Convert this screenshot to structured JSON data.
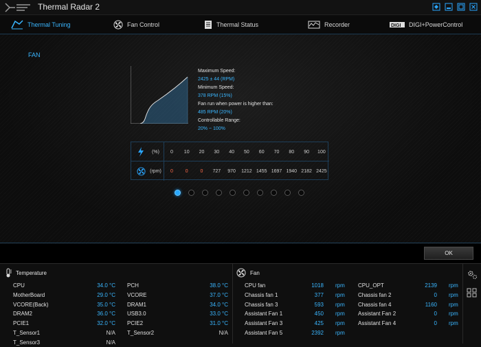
{
  "app": {
    "title": "Thermal Radar 2"
  },
  "tabs": [
    {
      "label": "Thermal Tuning",
      "icon": "thermal-tuning-icon"
    },
    {
      "label": "Fan Control",
      "icon": "fan-icon"
    },
    {
      "label": "Thermal Status",
      "icon": "document-icon"
    },
    {
      "label": "Recorder",
      "icon": "recorder-icon"
    },
    {
      "label": "DIGI+PowerControl",
      "icon": "digi-icon"
    }
  ],
  "fan_section": {
    "title": "FAN",
    "max_speed_label": "Maximum Speed:",
    "max_speed_value": "2425 ± 44 (RPM)",
    "min_speed_label": "Minimum Speed:",
    "min_speed_value": "378 RPM (15%)",
    "fan_run_label": "Fan run when power is higher than:",
    "fan_run_value": "485 RPM (20%)",
    "range_label": "Controllable Range:",
    "range_value": "20% ~ 100%",
    "table": {
      "pct_unit": "(%)",
      "rpm_unit": "(rpm)",
      "percent": [
        "0",
        "10",
        "20",
        "30",
        "40",
        "50",
        "60",
        "70",
        "80",
        "90",
        "100"
      ],
      "rpm": [
        "0",
        "0",
        "0",
        "727",
        "970",
        "1212",
        "1455",
        "1697",
        "1940",
        "2182",
        "2425"
      ]
    },
    "pager": {
      "count": 10,
      "active": 0
    }
  },
  "ok_label": "OK",
  "temperature": {
    "title": "Temperature",
    "left": [
      {
        "name": "CPU",
        "value": "34.0 °C"
      },
      {
        "name": "MotherBoard",
        "value": "29.0 °C"
      },
      {
        "name": "VCORE(Back)",
        "value": "35.0 °C"
      },
      {
        "name": "DRAM2",
        "value": "36.0 °C"
      },
      {
        "name": "PCIE1",
        "value": "32.0 °C"
      },
      {
        "name": "T_Sensor1",
        "value": "N/A"
      },
      {
        "name": "T_Sensor3",
        "value": "N/A"
      }
    ],
    "right": [
      {
        "name": "PCH",
        "value": "38.0 °C"
      },
      {
        "name": "VCORE",
        "value": "37.0 °C"
      },
      {
        "name": "DRAM1",
        "value": "34.0 °C"
      },
      {
        "name": "USB3.0",
        "value": "33.0 °C"
      },
      {
        "name": "PCIE2",
        "value": "31.0 °C"
      },
      {
        "name": "T_Sensor2",
        "value": "N/A"
      }
    ]
  },
  "fans": {
    "title": "Fan",
    "unit": "rpm",
    "left": [
      {
        "name": "CPU fan",
        "value": "1018"
      },
      {
        "name": "Chassis fan 1",
        "value": "377"
      },
      {
        "name": "Chassis fan 3",
        "value": "593"
      },
      {
        "name": "Assistant Fan 1",
        "value": "450"
      },
      {
        "name": "Assistant Fan 3",
        "value": "425"
      },
      {
        "name": "Assistant Fan 5",
        "value": "2392"
      }
    ],
    "right": [
      {
        "name": "CPU_OPT",
        "value": "2139"
      },
      {
        "name": "Chassis fan 2",
        "value": "0"
      },
      {
        "name": "Chassis fan 4",
        "value": "1160"
      },
      {
        "name": "Assistant Fan 2",
        "value": "0"
      },
      {
        "name": "Assistant Fan 4",
        "value": "0"
      }
    ]
  },
  "colors": {
    "accent": "#3ab6ff",
    "warning": "#ff6a4a",
    "background": "#0d0d0d"
  }
}
